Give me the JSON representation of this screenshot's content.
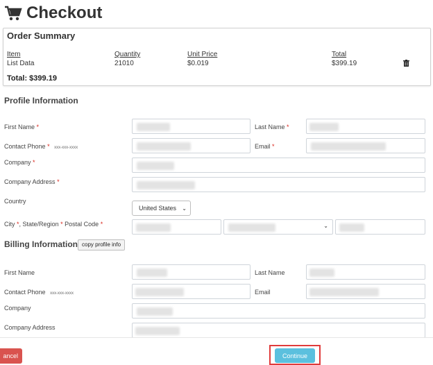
{
  "page": {
    "title": "Checkout"
  },
  "order_summary": {
    "title": "Order Summary",
    "columns": {
      "item": "Item",
      "quantity": "Quantity",
      "unit_price": "Unit Price",
      "total": "Total"
    },
    "row": {
      "item": "List Data",
      "quantity": "21010",
      "unit_price": "$0.019",
      "total": "$399.19"
    },
    "grand_total": "Total: $399.19"
  },
  "profile": {
    "heading": "Profile Information",
    "first_name": "First Name",
    "last_name": "Last Name",
    "contact_phone": "Contact Phone",
    "phone_hint": "xxx-xxx-xxxx",
    "email": "Email",
    "company": "Company",
    "company_address": "Company Address",
    "country": "Country",
    "country_value": "United States",
    "city": "City",
    "state_region": "State/Region",
    "postal_code": "Postal Code",
    "required_mark": "*"
  },
  "billing": {
    "heading": "Billing Information",
    "copy_button": "copy profile info",
    "first_name": "First Name",
    "last_name": "Last Name",
    "contact_phone": "Contact Phone",
    "phone_hint": "xxx-xxx-xxxx",
    "email": "Email",
    "company": "Company",
    "company_address": "Company Address"
  },
  "actions": {
    "cancel": "ancel",
    "continue": "Continue"
  },
  "colors": {
    "required": "#d9261c",
    "cancel": "#d9534f",
    "continue": "#5bc0de",
    "highlight": "#e03b3b"
  }
}
